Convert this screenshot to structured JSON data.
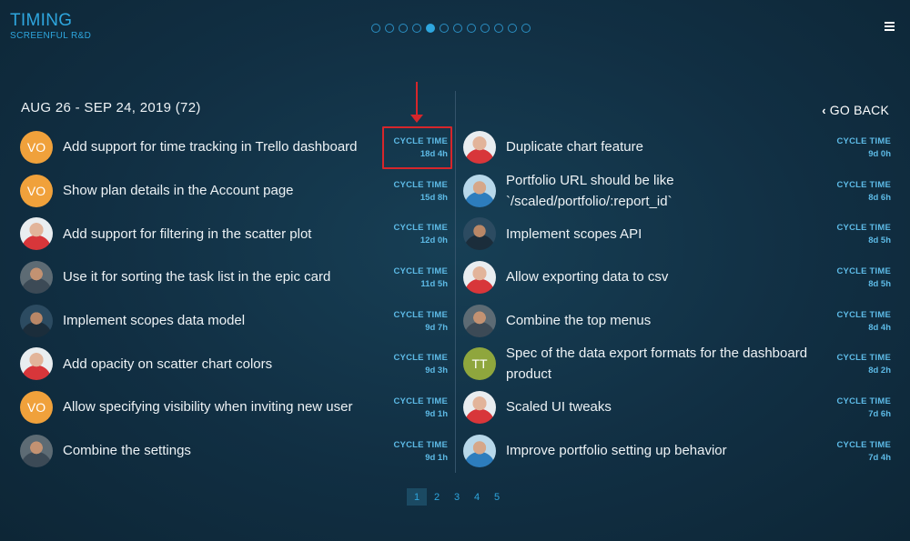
{
  "brand": {
    "title": "TIMING",
    "subtitle": "SCREENFUL R&D"
  },
  "carousel": {
    "count": 12,
    "active_index": 4
  },
  "period": "AUG 26 - SEP 24, 2019 (72)",
  "go_back": "GO BACK",
  "cycle_label": "CYCLE TIME",
  "left_tasks": [
    {
      "avatar": "initials-vo",
      "initials": "VO",
      "title": "Add support for time tracking in Trello dashboard",
      "cycle_time": "18d 4h"
    },
    {
      "avatar": "initials-vo",
      "initials": "VO",
      "title": "Show plan details in the Account page",
      "cycle_time": "15d 8h"
    },
    {
      "avatar": "photo-a",
      "initials": "",
      "title": "Add support for filtering in the scatter plot",
      "cycle_time": "12d 0h"
    },
    {
      "avatar": "photo-b",
      "initials": "",
      "title": "Use it for sorting the task list in the epic card",
      "cycle_time": "11d 5h"
    },
    {
      "avatar": "photo-c",
      "initials": "",
      "title": "Implement scopes data model",
      "cycle_time": "9d 7h"
    },
    {
      "avatar": "photo-a",
      "initials": "",
      "title": "Add opacity on scatter chart colors",
      "cycle_time": "9d 3h"
    },
    {
      "avatar": "initials-vo",
      "initials": "VO",
      "title": "Allow specifying visibility when inviting new user",
      "cycle_time": "9d 1h"
    },
    {
      "avatar": "photo-b",
      "initials": "",
      "title": "Combine the settings",
      "cycle_time": "9d 1h"
    }
  ],
  "right_tasks": [
    {
      "avatar": "photo-a",
      "initials": "",
      "title": "Duplicate chart feature",
      "cycle_time": "9d 0h"
    },
    {
      "avatar": "photo-d",
      "initials": "",
      "title": "Portfolio URL should be like `/scaled/portfolio/:report_id`",
      "cycle_time": "8d 6h"
    },
    {
      "avatar": "photo-c",
      "initials": "",
      "title": "Implement scopes API",
      "cycle_time": "8d 5h"
    },
    {
      "avatar": "photo-a",
      "initials": "",
      "title": "Allow exporting data to csv",
      "cycle_time": "8d 5h"
    },
    {
      "avatar": "photo-b",
      "initials": "",
      "title": "Combine the top menus",
      "cycle_time": "8d 4h"
    },
    {
      "avatar": "initials-tt",
      "initials": "TT",
      "title": "Spec of the data export formats for the dashboard product",
      "cycle_time": "8d 2h"
    },
    {
      "avatar": "photo-a",
      "initials": "",
      "title": "Scaled UI tweaks",
      "cycle_time": "7d 6h"
    },
    {
      "avatar": "photo-d",
      "initials": "",
      "title": "Improve portfolio setting up behavior",
      "cycle_time": "7d 4h"
    }
  ],
  "pagination": {
    "pages": [
      "1",
      "2",
      "3",
      "4",
      "5"
    ],
    "active": "1"
  },
  "colors": {
    "accent": "#2ea6de",
    "highlight": "#d6262b",
    "avatar_vo": "#f0a13b",
    "avatar_tt": "#8fa63d"
  }
}
